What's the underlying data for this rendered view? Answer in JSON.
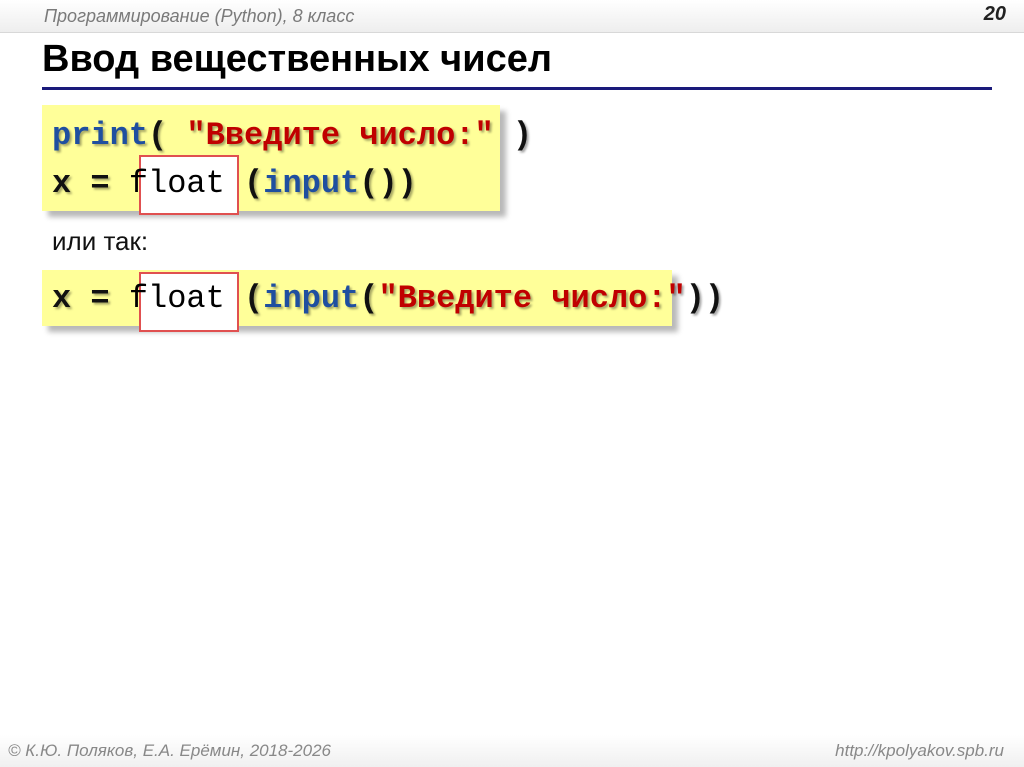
{
  "header": {
    "course": "Программирование (Python), 8 класс",
    "page_number": "20"
  },
  "slide": {
    "title": "Ввод вещественных чисел",
    "example1": {
      "line1": {
        "kw": "print",
        "pre": "( ",
        "str": "\"Введите число:\"",
        "post": " )"
      },
      "line2": {
        "pre": "x = ",
        "fn": "float",
        "mid": " (",
        "kw": "input",
        "post": "())"
      }
    },
    "alt_text": "или так:",
    "example2": {
      "pre": "x = ",
      "fn": "float",
      "mid": " (",
      "kw": "input",
      "open": "(",
      "str": "\"Введите число:\"",
      "post": "))"
    }
  },
  "footer": {
    "copyright": "© К.Ю. Поляков, Е.А. Ерёмин, 2018-2026",
    "url": "http://kpolyakov.spb.ru"
  },
  "colors": {
    "code_background": "#ffff99",
    "keyword": "#1f4fa0",
    "string": "#c00000",
    "title_rule": "#1a1a7a",
    "highlight_border": "#e05050"
  }
}
